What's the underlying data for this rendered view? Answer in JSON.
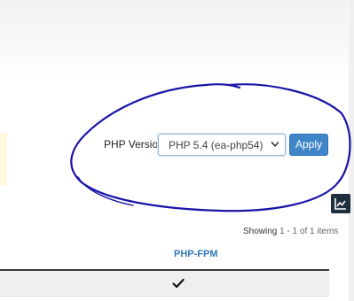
{
  "php_version": {
    "label": "PHP Version",
    "selected": "PHP 5.4 (ea-php54)",
    "apply_label": "Apply"
  },
  "pagination": {
    "showing_label": "Showing",
    "range": "1 - 1 of 1 items"
  },
  "table": {
    "columns": [
      "PHP-FPM"
    ],
    "rows": [
      {
        "php_fpm": "enabled"
      }
    ]
  },
  "icons": {
    "select_chevron": "chevron-down-icon",
    "chart_button": "trend-chart-icon",
    "row_status": "check-icon"
  },
  "colors": {
    "accent": "#3f86c9",
    "link": "#2f77b8",
    "annotation_ink": "#1a14a8",
    "chart_button_bg": "#1f2f3e"
  }
}
